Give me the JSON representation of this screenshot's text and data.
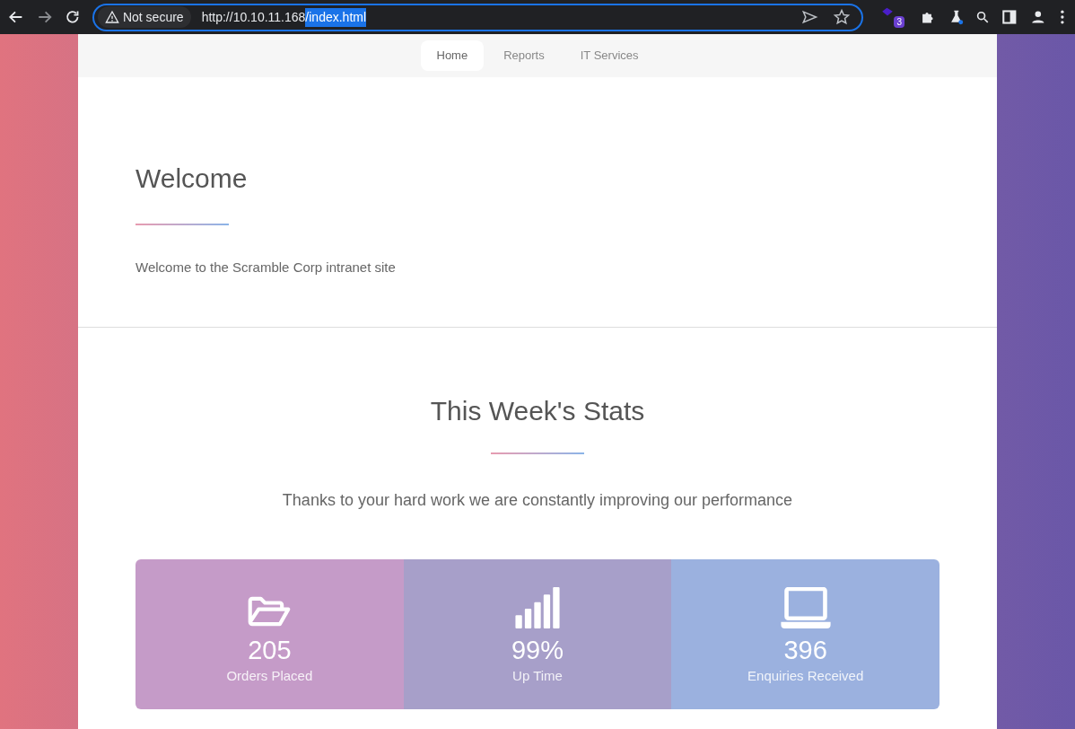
{
  "browser": {
    "security": "Not secure",
    "url_host": "http://10.10.11.168",
    "url_path": "/index.html",
    "extension_badge": "3"
  },
  "nav": [
    {
      "label": "Home",
      "selected": true
    },
    {
      "label": "Reports",
      "selected": false
    },
    {
      "label": "IT Services",
      "selected": false
    }
  ],
  "welcome": {
    "title": "Welcome",
    "text": "Welcome to the Scramble Corp intranet site"
  },
  "stats": {
    "title": "This Week's Stats",
    "subtitle": "Thanks to your hard work we are constantly improving our performance",
    "items": [
      {
        "value": "205",
        "label": "Orders Placed",
        "color": "#c59bc8"
      },
      {
        "value": "99%",
        "label": "Up Time",
        "color": "#a79fc9"
      },
      {
        "value": "396",
        "label": "Enquiries Received",
        "color": "#9bb1df"
      }
    ]
  }
}
